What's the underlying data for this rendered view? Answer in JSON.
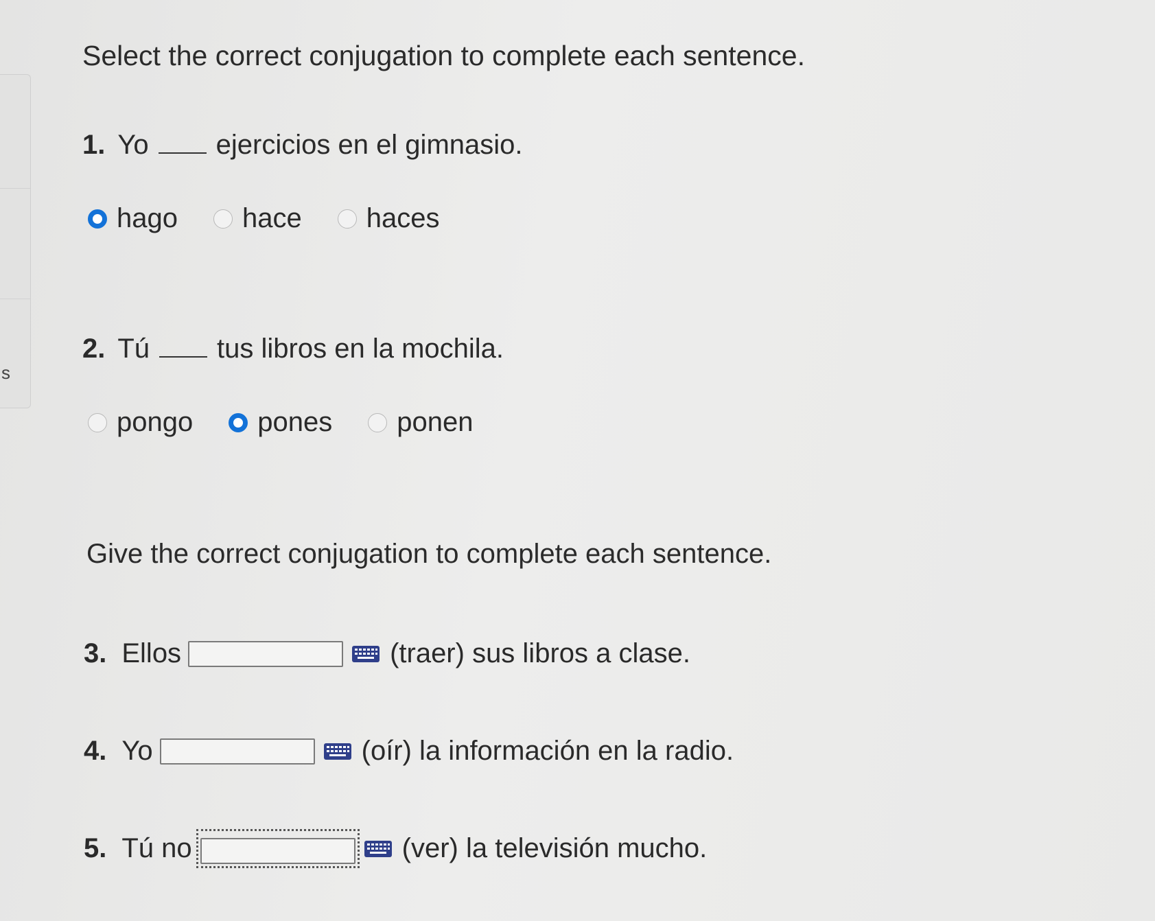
{
  "side": {
    "letter": "s"
  },
  "section1": {
    "heading": "Select the correct conjugation to complete each sentence.",
    "questions": [
      {
        "number": "1.",
        "before": "Yo",
        "after": "ejercicios en el gimnasio.",
        "options": [
          {
            "label": "hago",
            "selected": true
          },
          {
            "label": "hace",
            "selected": false
          },
          {
            "label": "haces",
            "selected": false
          }
        ]
      },
      {
        "number": "2.",
        "before": "Tú",
        "after": "tus libros en la mochila.",
        "options": [
          {
            "label": "pongo",
            "selected": false
          },
          {
            "label": "pones",
            "selected": true
          },
          {
            "label": "ponen",
            "selected": false
          }
        ]
      }
    ]
  },
  "section2": {
    "heading": "Give the correct conjugation to complete each sentence.",
    "questions": [
      {
        "number": "3.",
        "before": "Ellos",
        "value": "",
        "after": "(traer) sus libros a clase.",
        "icon": "keyboard-icon"
      },
      {
        "number": "4.",
        "before": "Yo",
        "value": "",
        "after": "(oír) la información en la radio.",
        "icon": "keyboard-icon"
      },
      {
        "number": "5.",
        "before": "Tú no",
        "value": "",
        "after": "(ver) la televisión mucho.",
        "icon": "keyboard-icon",
        "focused": true
      }
    ]
  },
  "colors": {
    "radio_selected": "#1372d8",
    "background": "#e9e9e8",
    "text": "#2a2a2a"
  }
}
